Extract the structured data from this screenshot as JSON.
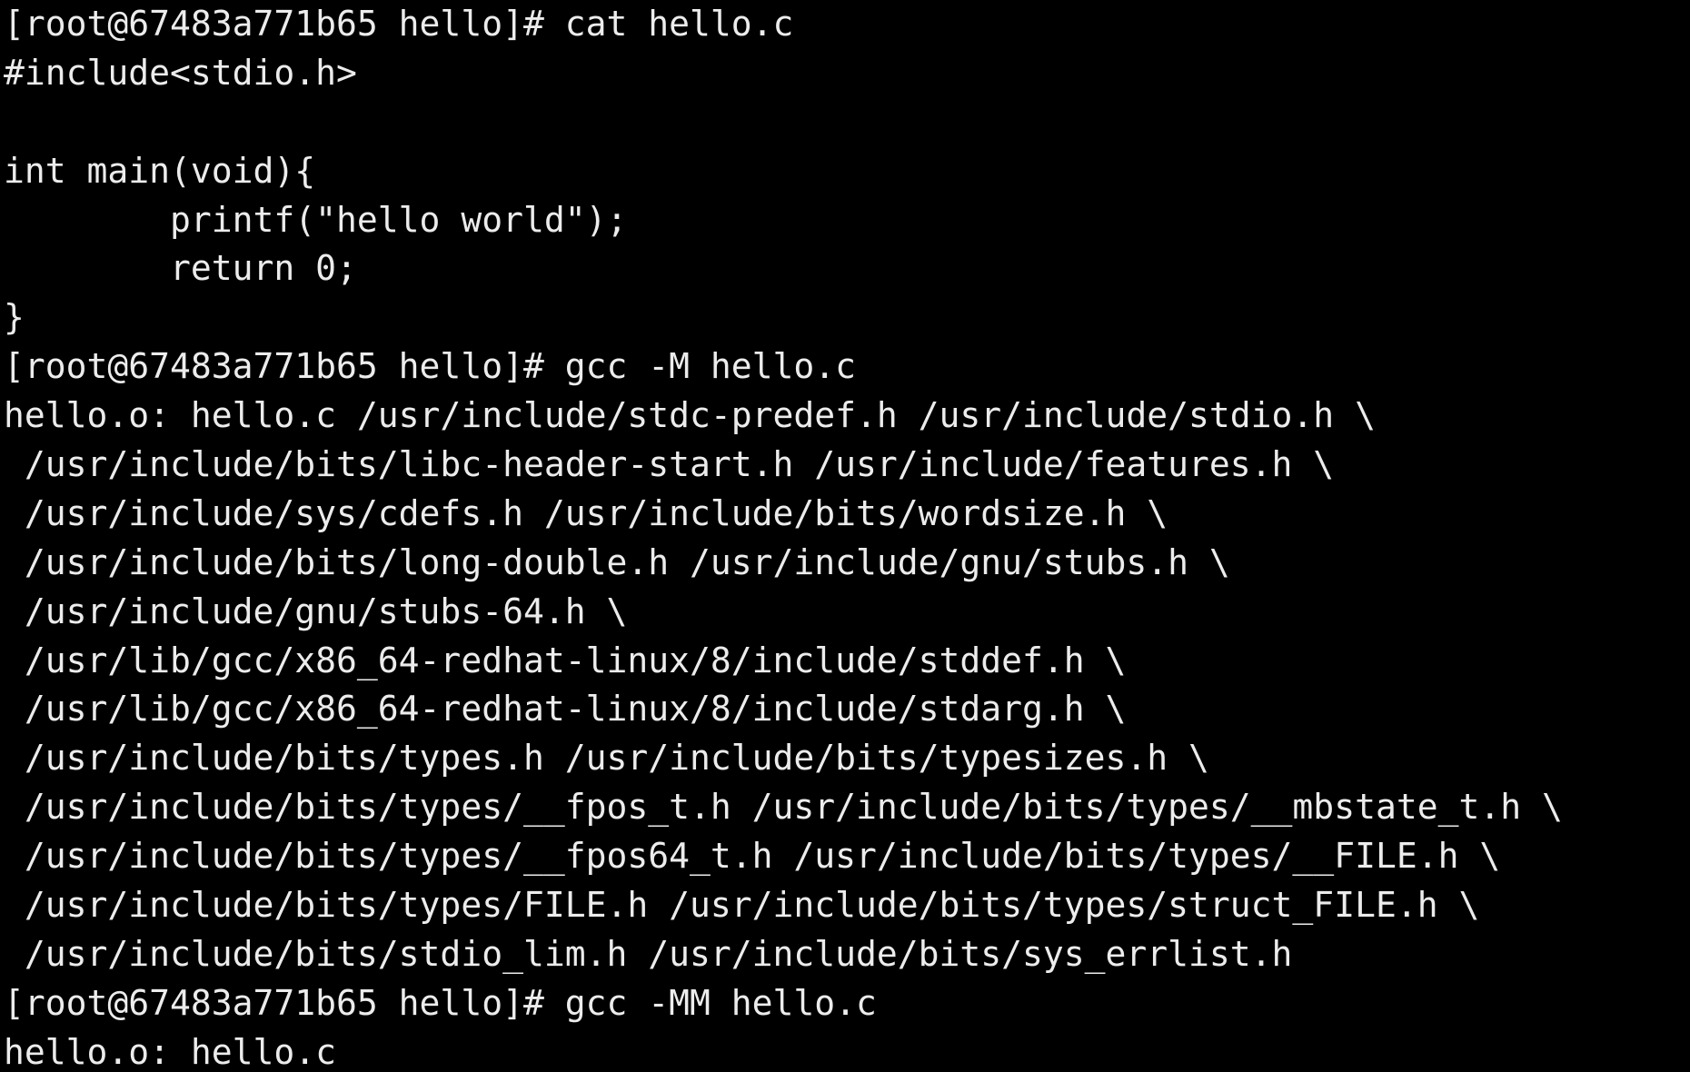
{
  "terminal": {
    "lines": [
      "[root@67483a771b65 hello]# cat hello.c",
      "#include<stdio.h>",
      "",
      "int main(void){",
      "        printf(\"hello world\");",
      "        return 0;",
      "}",
      "[root@67483a771b65 hello]# gcc -M hello.c",
      "hello.o: hello.c /usr/include/stdc-predef.h /usr/include/stdio.h \\",
      " /usr/include/bits/libc-header-start.h /usr/include/features.h \\",
      " /usr/include/sys/cdefs.h /usr/include/bits/wordsize.h \\",
      " /usr/include/bits/long-double.h /usr/include/gnu/stubs.h \\",
      " /usr/include/gnu/stubs-64.h \\",
      " /usr/lib/gcc/x86_64-redhat-linux/8/include/stddef.h \\",
      " /usr/lib/gcc/x86_64-redhat-linux/8/include/stdarg.h \\",
      " /usr/include/bits/types.h /usr/include/bits/typesizes.h \\",
      " /usr/include/bits/types/__fpos_t.h /usr/include/bits/types/__mbstate_t.h \\",
      " /usr/include/bits/types/__fpos64_t.h /usr/include/bits/types/__FILE.h \\",
      " /usr/include/bits/types/FILE.h /usr/include/bits/types/struct_FILE.h \\",
      " /usr/include/bits/stdio_lim.h /usr/include/bits/sys_errlist.h",
      "[root@67483a771b65 hello]# gcc -MM hello.c",
      "hello.o: hello.c"
    ]
  },
  "colors": {
    "background": "#000000",
    "foreground": "#ececec"
  }
}
